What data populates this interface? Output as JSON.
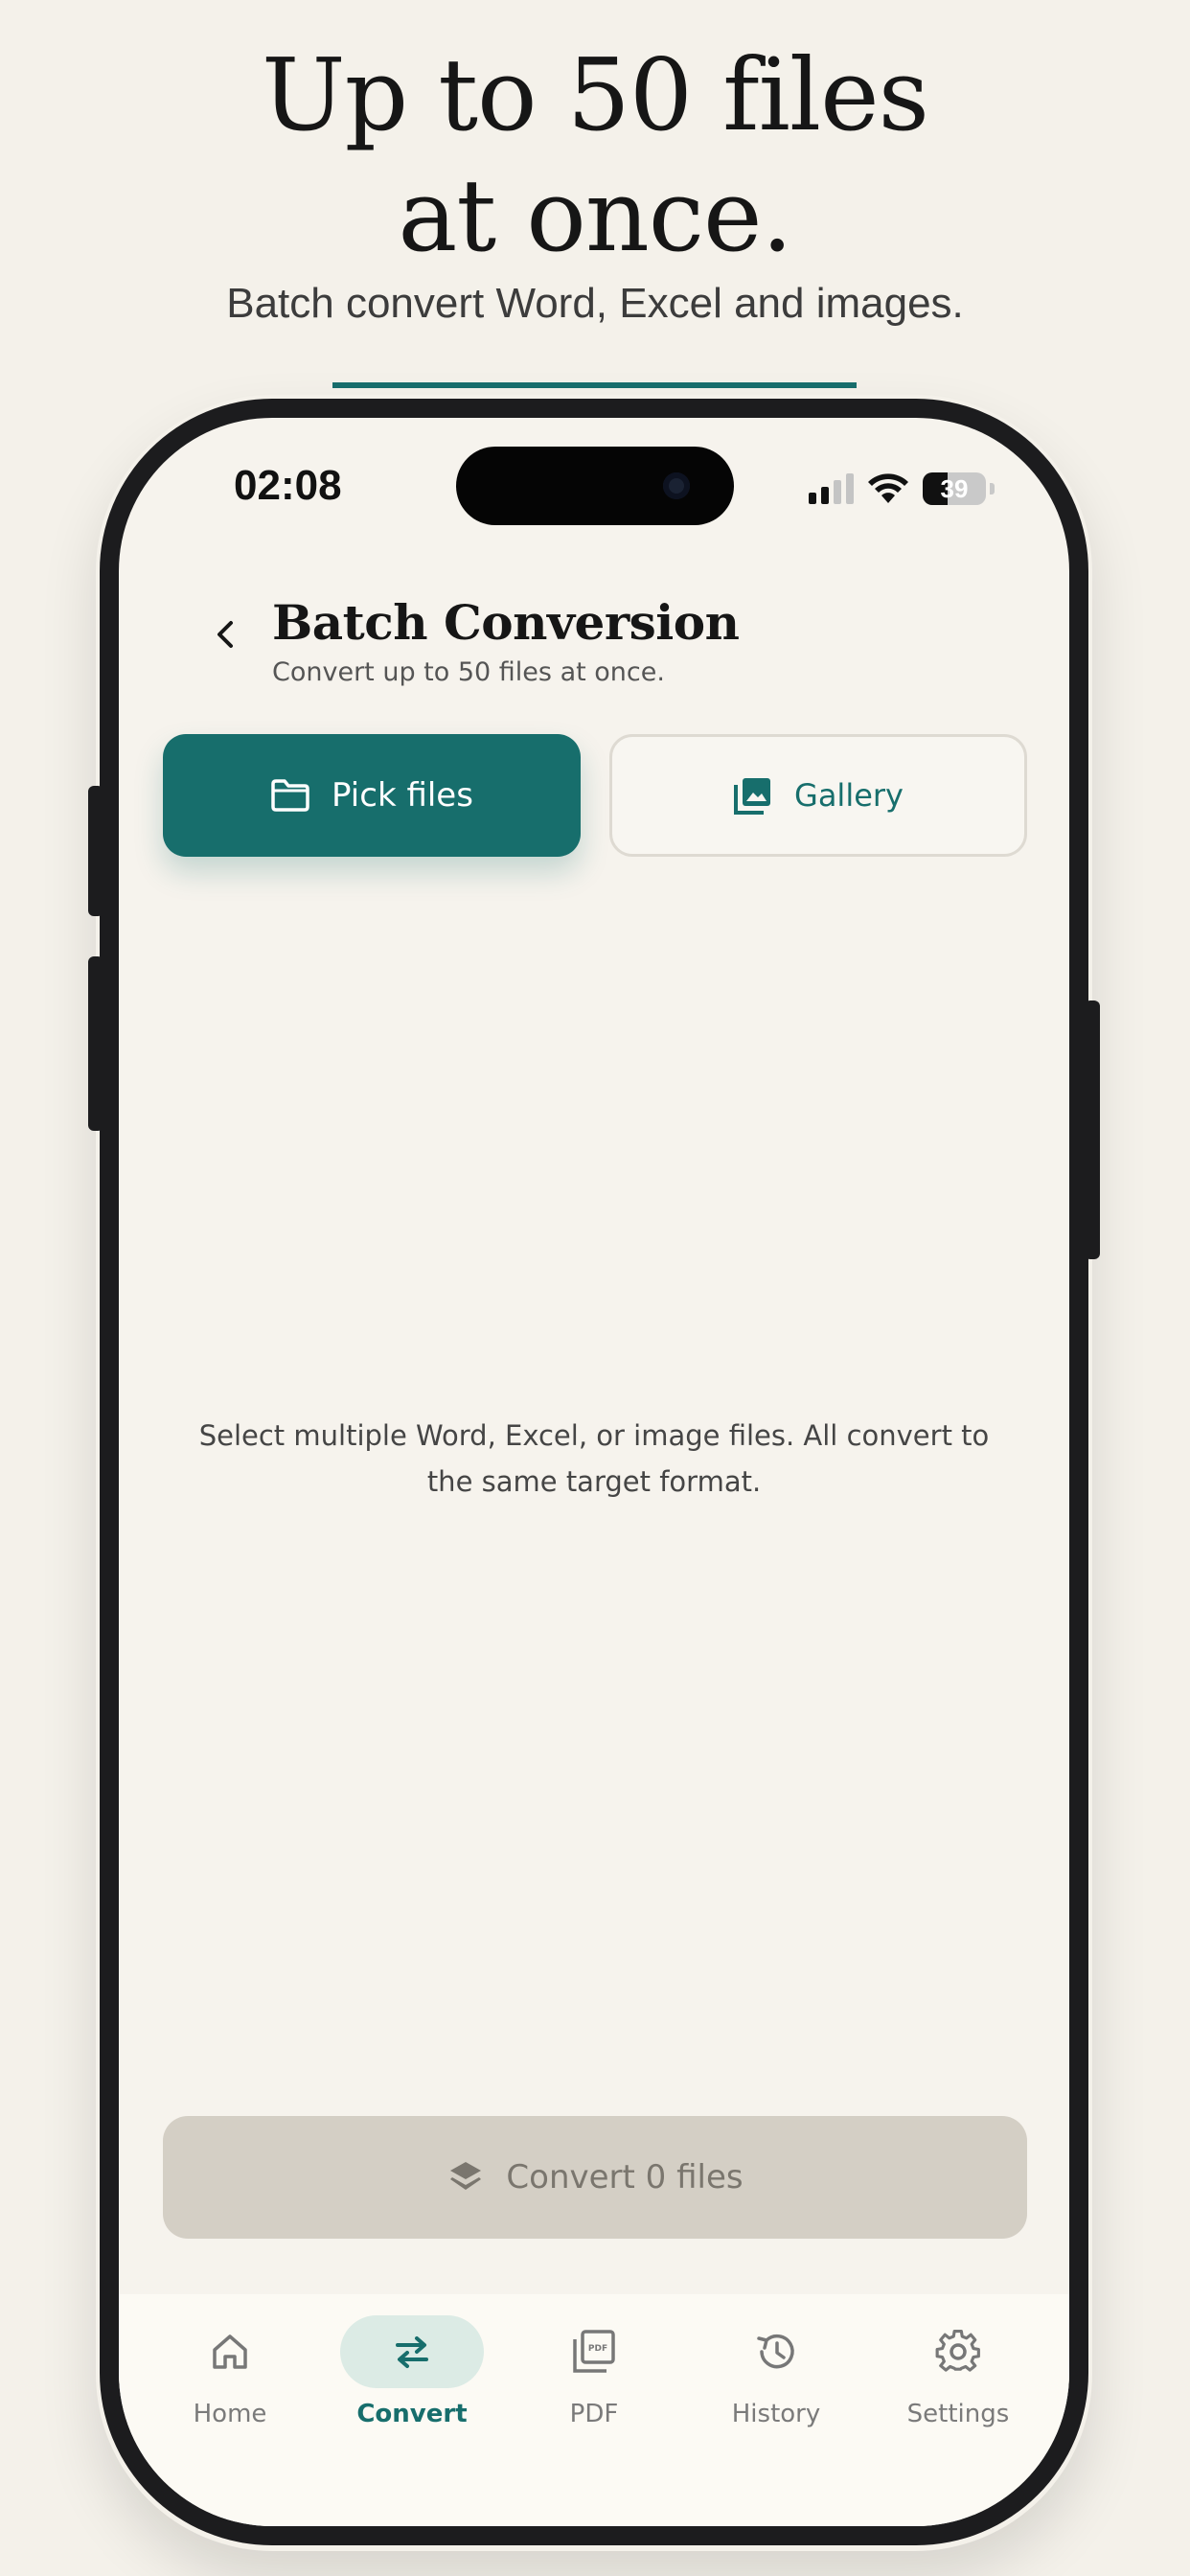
{
  "promo": {
    "title_line1": "Up to 50 files",
    "title_line2": "at once.",
    "subtitle": "Batch convert Word, Excel and images.",
    "accent_color": "#186e6c"
  },
  "status_bar": {
    "time": "02:08",
    "battery": "39",
    "battery_level": 0.39
  },
  "header": {
    "back_icon": "chevron-left-icon",
    "title": "Batch Conversion",
    "subtitle": "Convert up to 50 files at once."
  },
  "actions": {
    "pick_label": "Pick files",
    "pick_icon": "folder-icon",
    "gallery_label": "Gallery",
    "gallery_icon": "image-gallery-icon"
  },
  "empty_state": {
    "message": "Select multiple Word, Excel, or image files. All convert to the same target format."
  },
  "convert": {
    "label": "Convert 0 files",
    "icon": "layers-icon",
    "enabled": false
  },
  "tabs": [
    {
      "label": "Home",
      "icon": "home-icon",
      "active": false
    },
    {
      "label": "Convert",
      "icon": "swap-arrows-icon",
      "active": true
    },
    {
      "label": "PDF",
      "icon": "pdf-icon",
      "active": false
    },
    {
      "label": "History",
      "icon": "history-icon",
      "active": false
    },
    {
      "label": "Settings",
      "icon": "gear-icon",
      "active": false
    }
  ],
  "colors": {
    "primary": "#176e6c",
    "background": "#f6f3ed",
    "disabled": "#d4cfc5",
    "tab_active_bg": "#dcebe5"
  }
}
